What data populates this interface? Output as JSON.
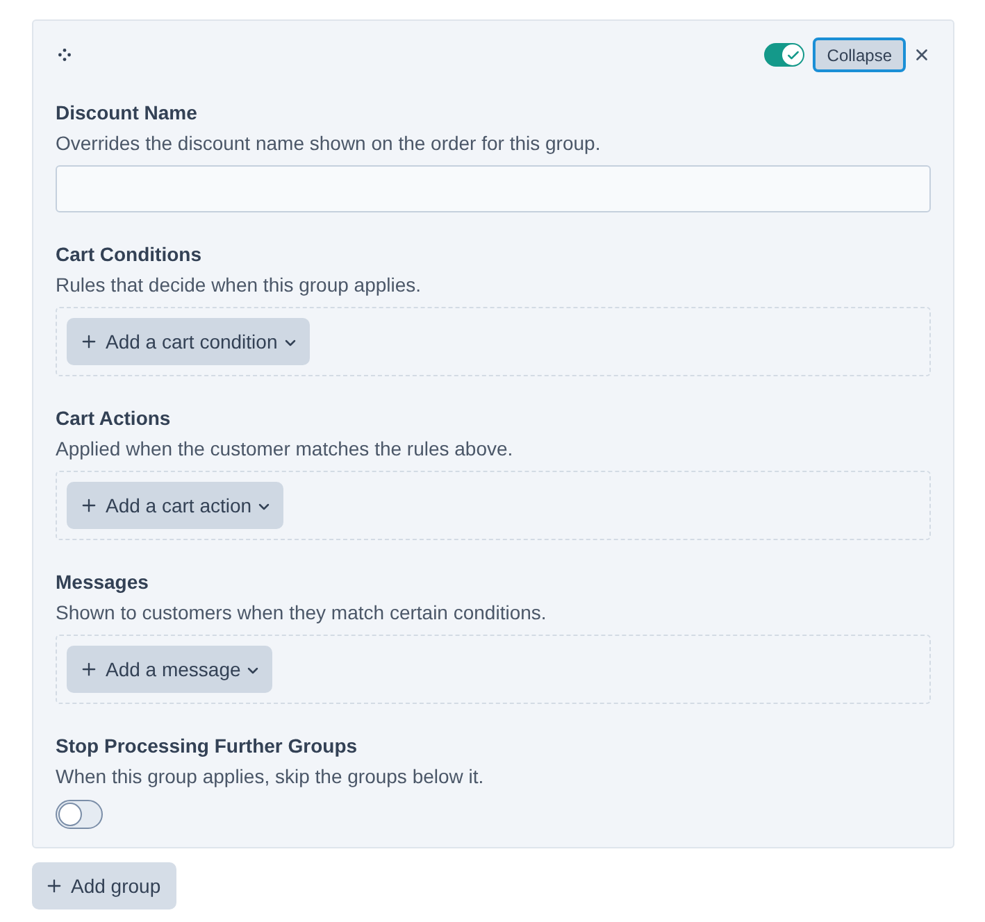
{
  "card": {
    "header": {
      "toggle": {
        "on": true
      },
      "collapse_button": {
        "label": "Collapse",
        "focused": true
      }
    },
    "sections": [
      {
        "kind": "text_input",
        "label": "Discount Name",
        "description": "Overrides the discount name shown on the order for this group."
      },
      {
        "kind": "add_list",
        "label": "Cart Conditions",
        "description": "Rules that decide when this group applies.",
        "add_button": "Add a cart condition"
      },
      {
        "kind": "add_list",
        "label": "Cart Actions",
        "description": "Applied when the customer matches the rules above.",
        "add_button": "Add a cart action"
      },
      {
        "kind": "add_list",
        "label": "Messages",
        "description": "Shown to customers when they match certain conditions.",
        "add_button": "Add a message"
      },
      {
        "kind": "toggle",
        "label": "Stop Processing Further Groups",
        "description": "When this group applies, skip the groups below it.",
        "on": false
      }
    ]
  },
  "add_group_button": {
    "label": "Add group"
  }
}
